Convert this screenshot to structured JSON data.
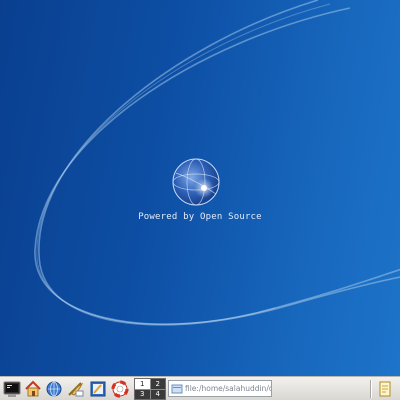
{
  "desktop": {
    "tagline": "Powered by Open Source",
    "background_colors": [
      "#0a3f8f",
      "#1d74c9"
    ]
  },
  "taskbar": {
    "launchers": [
      {
        "name": "terminal-icon"
      },
      {
        "name": "home-folder-icon"
      },
      {
        "name": "konqueror-icon"
      },
      {
        "name": "kmail-icon"
      },
      {
        "name": "kate-icon"
      },
      {
        "name": "help-lifebuoy-icon"
      }
    ],
    "pager": {
      "desktops": [
        "1",
        "2",
        "3",
        "4"
      ],
      "active": "1"
    },
    "location_bar": {
      "value": "file:/home/salahuddin/desi"
    },
    "tray_icon": "notes-icon"
  }
}
